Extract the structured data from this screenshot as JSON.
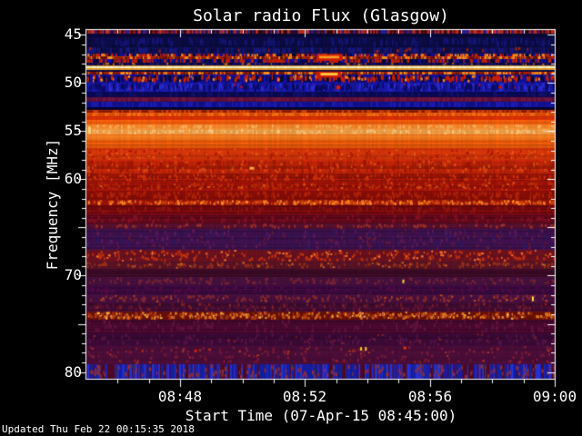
{
  "title": "Solar radio Flux (Glasgow)",
  "updated_text": "Updated Thu Feb 22 00:15:35 2018",
  "colors": {
    "background": "#000000",
    "foreground": "#ffffff"
  },
  "axes": {
    "x": {
      "label": "Start Time (07-Apr-15 08:45:00)",
      "ticks": [
        {
          "label": "08:48",
          "minutes": 3
        },
        {
          "label": "08:52",
          "minutes": 7
        },
        {
          "label": "08:56",
          "minutes": 11
        },
        {
          "label": "09:00",
          "minutes": 15
        }
      ],
      "minor_every_minutes": 1,
      "major_minutes": [
        3,
        7,
        11,
        15
      ]
    },
    "y": {
      "label": "Frequency [MHz]",
      "ticks": [
        {
          "label": "45",
          "mhz": 45
        },
        {
          "label": "50",
          "mhz": 50
        },
        {
          "label": "55",
          "mhz": 55
        },
        {
          "label": "60",
          "mhz": 60
        },
        {
          "label": "70",
          "mhz": 70
        },
        {
          "label": "80",
          "mhz": 80
        }
      ],
      "major_every_mhz": 5,
      "minor_every_mhz": 1
    }
  },
  "chart_data": {
    "type": "heatmap",
    "title": "Solar radio Flux (Glasgow)",
    "xlabel": "Start Time (07-Apr-15 08:45:00)",
    "ylabel": "Frequency [MHz]",
    "x_start_time": "08:45",
    "x_end_time": "09:00",
    "x_range_minutes": [
      0,
      15
    ],
    "y_range_mhz": [
      44.5,
      80.7
    ],
    "y_axis_inverted": true,
    "palette": "blue-red thermal (blue=low, red/orange=high, yellow/white=peak)",
    "notable_features": [
      "continuous bright yellow-white horizontal line near 48.4 MHz",
      "blue interference bands 47-52 MHz with red vertical bursts",
      "broad bright red-orange emission 53-60 MHz peaking near 55 MHz",
      "bright dashed rows near 62.4 and 74 MHz",
      "sustained burst segments 08:52:20-08:53:10 at 47.3 and 49.1 MHz",
      "blue vertical streaks along bottom edge near 80 MHz"
    ],
    "bands": [
      {
        "f0": 44.5,
        "f1": 44.85,
        "base": "#991414",
        "rj": 0.25,
        "st": [
          {
            "c": "#2222aa",
            "d": 0.45,
            "full": true
          },
          {
            "c": "#330808",
            "d": 0.3,
            "full": true
          },
          {
            "c": "#cc3322",
            "d": 0.2,
            "full": true
          }
        ]
      },
      {
        "f0": 44.85,
        "f1": 45.3,
        "base": "#0a0a3a",
        "rj": 0.15,
        "col": 0.3
      },
      {
        "f0": 45.3,
        "f1": 46.3,
        "base": "#0d0d48",
        "rj": 0.18,
        "col": 0.35,
        "st": [
          {
            "c": "#15157a",
            "d": 0.25,
            "h": 6
          }
        ]
      },
      {
        "f0": 46.3,
        "f1": 46.95,
        "base": "#111158",
        "rj": 0.18,
        "col": 0.35,
        "st": [
          {
            "c": "#1a1a80",
            "d": 0.25,
            "h": 5
          },
          {
            "c": "#aa2200",
            "d": 0.03,
            "h": 3
          }
        ]
      },
      {
        "f0": 46.95,
        "f1": 47.25,
        "base": "#1212a8",
        "col": 0.3,
        "st": [
          {
            "c": "#070733",
            "d": 0.35,
            "h": 6
          },
          {
            "c": "#cc2200",
            "d": 0.28,
            "h": 5
          },
          {
            "c": "#ff8822",
            "d": 0.15,
            "h": 3
          }
        ]
      },
      {
        "f0": 47.25,
        "f1": 47.55,
        "base": "#b32505",
        "rj": 0.25,
        "st": [
          {
            "c": "#ff9922",
            "d": 0.3,
            "h": 3
          },
          {
            "c": "#6a1202",
            "d": 0.25,
            "h": 3
          }
        ]
      },
      {
        "f0": 47.55,
        "f1": 47.85,
        "base": "#1212a8",
        "col": 0.3,
        "st": [
          {
            "c": "#070733",
            "d": 0.3,
            "h": 5
          },
          {
            "c": "#cc2200",
            "d": 0.28,
            "h": 4
          }
        ]
      },
      {
        "f0": 47.85,
        "f1": 48.18,
        "base": "#0a0a47",
        "rj": 0.15,
        "st": [
          {
            "c": "#e07818",
            "d": 0.12,
            "h": 2
          },
          {
            "c": "#131370",
            "d": 0.25,
            "h": 4
          }
        ]
      },
      {
        "f0": 48.18,
        "f1": 48.3,
        "base": "#e8a028",
        "rj": 0.15
      },
      {
        "f0": 48.3,
        "f1": 48.5,
        "base": "#ffffd8",
        "rj": 0.05
      },
      {
        "f0": 48.5,
        "f1": 48.62,
        "base": "#e8a028",
        "rj": 0.15
      },
      {
        "f0": 48.62,
        "f1": 48.85,
        "base": "#0a0a47",
        "rj": 0.15
      },
      {
        "f0": 48.85,
        "f1": 49.15,
        "base": "#b32505",
        "rj": 0.25,
        "st": [
          {
            "c": "#ff9922",
            "d": 0.35,
            "h": 3
          },
          {
            "c": "#6a1202",
            "d": 0.2,
            "h": 3
          }
        ]
      },
      {
        "f0": 49.15,
        "f1": 49.95,
        "base": "#1212a8",
        "col": 0.3,
        "st": [
          {
            "c": "#070733",
            "d": 0.3,
            "h": 6
          },
          {
            "c": "#cc2200",
            "d": 0.3,
            "h": 5
          },
          {
            "c": "#ff8822",
            "d": 0.1,
            "h": 3
          }
        ]
      },
      {
        "f0": 49.95,
        "f1": 50.9,
        "base": "#1a1ab4",
        "col": 0.4,
        "st": [
          {
            "c": "#2e2ed8",
            "d": 0.3,
            "h": 5
          },
          {
            "c": "#0b0b66",
            "d": 0.3,
            "h": 6
          },
          {
            "c": "#aa1133",
            "d": 0.015,
            "h": 3
          }
        ]
      },
      {
        "f0": 50.9,
        "f1": 51.45,
        "base": "#0a0a52",
        "rj": 0.15,
        "st": [
          {
            "c": "#12126a",
            "d": 0.2,
            "h": 5
          }
        ]
      },
      {
        "f0": 51.45,
        "f1": 51.95,
        "base": "#5c1038",
        "rj": 0.2,
        "st": [
          {
            "c": "#7a1844",
            "d": 0.3,
            "h": 4
          }
        ]
      },
      {
        "f0": 51.95,
        "f1": 52.55,
        "base": "#131398",
        "col": 0.3,
        "st": [
          {
            "c": "#1e1eb8",
            "d": 0.25,
            "h": 5
          }
        ]
      },
      {
        "f0": 52.55,
        "f1": 52.8,
        "base": "#070736",
        "rj": 0.2
      },
      {
        "f0": 52.8,
        "f1": 53.05,
        "base": "#a82408",
        "rj": 0.25,
        "st": [
          {
            "c": "#d84410",
            "d": 0.3,
            "h": 3
          }
        ]
      },
      {
        "f0": 53.05,
        "f1": 53.45,
        "base": "#e04c06",
        "rj": 0.1,
        "st": [
          {
            "c": "#ff7715",
            "d": 0.25,
            "h": 3
          }
        ]
      },
      {
        "f0": 53.45,
        "f1": 53.85,
        "base": "#d83004",
        "rj": 0.1
      },
      {
        "f0": 53.85,
        "f1": 54.35,
        "base": "#ef5c0c",
        "rj": 0.1
      },
      {
        "f0": 54.35,
        "f1": 54.75,
        "base": "#ff8c2c",
        "rj": 0.1,
        "st": [
          {
            "c": "#ffb35c",
            "d": 0.2,
            "h": 3
          }
        ]
      },
      {
        "f0": 54.75,
        "f1": 55.35,
        "base": "#ffa448",
        "rj": 0.1,
        "st": [
          {
            "c": "#ffc87c",
            "d": 0.25,
            "h": 3
          }
        ]
      },
      {
        "f0": 55.35,
        "f1": 55.95,
        "base": "#f87c1e",
        "rj": 0.1
      },
      {
        "f0": 55.95,
        "f1": 56.75,
        "base": "#ea5a0a",
        "rj": 0.12
      },
      {
        "f0": 56.75,
        "f1": 57.95,
        "base": "#d8360a",
        "rj": 0.15,
        "st": [
          {
            "c": "#f05c14",
            "d": 0.2,
            "h": 2
          },
          {
            "c": "#b81e04",
            "d": 0.2,
            "h": 3
          }
        ]
      },
      {
        "f0": 57.95,
        "f1": 59.35,
        "base": "#c62608",
        "rj": 0.18,
        "col": 0.25,
        "st": [
          {
            "c": "#e44c10",
            "d": 0.25,
            "h": 3
          },
          {
            "c": "#a51404",
            "d": 0.3,
            "h": 4
          }
        ]
      },
      {
        "f0": 59.35,
        "f1": 60.25,
        "base": "#ac1808",
        "rj": 0.2,
        "col": 0.25,
        "st": [
          {
            "c": "#d4340a",
            "d": 0.3,
            "h": 3
          }
        ]
      },
      {
        "f0": 60.25,
        "f1": 61.15,
        "base": "#9a1208",
        "rj": 0.15,
        "st": [
          {
            "c": "#c42c08",
            "d": 0.4,
            "h": 3
          },
          {
            "c": "#e86018",
            "d": 0.08,
            "h": 2
          }
        ]
      },
      {
        "f0": 61.15,
        "f1": 62.15,
        "base": "#8c0e08",
        "rj": 0.15,
        "st": [
          {
            "c": "#b42408",
            "d": 0.4,
            "h": 4
          }
        ]
      },
      {
        "f0": 62.15,
        "f1": 62.7,
        "base": "#9c1404",
        "st": [
          {
            "c": "#ff8824",
            "d": 0.45,
            "h": 3
          },
          {
            "c": "#d44210",
            "d": 0.3,
            "h": 3
          }
        ]
      },
      {
        "f0": 62.7,
        "f1": 63.6,
        "base": "#740a0e",
        "rj": 0.18,
        "st": [
          {
            "c": "#921610",
            "d": 0.25,
            "h": 4
          }
        ]
      },
      {
        "f0": 63.6,
        "f1": 64.6,
        "base": "#61091c",
        "rj": 0.18,
        "st": [
          {
            "c": "#851225",
            "d": 0.25,
            "h": 4
          }
        ]
      },
      {
        "f0": 64.6,
        "f1": 65.1,
        "base": "#551030",
        "rj": 0.2,
        "st": [
          {
            "c": "#a33028",
            "d": 0.2,
            "h": 3
          }
        ]
      },
      {
        "f0": 65.1,
        "f1": 67.3,
        "base": "#3f1250",
        "rj": 0.2,
        "st": [
          {
            "c": "#5c1c5c",
            "d": 0.28,
            "h": 4
          },
          {
            "c": "#2c1a66",
            "d": 0.1,
            "h": 5
          },
          {
            "c": "#6a1a34",
            "d": 0.12,
            "h": 3
          }
        ]
      },
      {
        "f0": 67.3,
        "f1": 68.5,
        "base": "#6e1220",
        "st": [
          {
            "c": "#c63410",
            "d": 0.42,
            "h": 3
          },
          {
            "c": "#ff7e33",
            "d": 0.12,
            "h": 2
          }
        ]
      },
      {
        "f0": 68.5,
        "f1": 69.3,
        "base": "#5a1426",
        "st": [
          {
            "c": "#9c3018",
            "d": 0.3,
            "h": 3
          },
          {
            "c": "#cc6422",
            "d": 0.07,
            "h": 2
          }
        ]
      },
      {
        "f0": 69.3,
        "f1": 70.1,
        "base": "#420c2a",
        "rj": 0.2
      },
      {
        "f0": 70.1,
        "f1": 71.0,
        "base": "#481240",
        "st": [
          {
            "c": "#7c2434",
            "d": 0.33,
            "h": 3
          }
        ]
      },
      {
        "f0": 71.0,
        "f1": 71.9,
        "base": "#3a0a3e",
        "rj": 0.2,
        "st": [
          {
            "c": "#520c46",
            "d": 0.28,
            "h": 4
          }
        ]
      },
      {
        "f0": 71.9,
        "f1": 72.8,
        "base": "#471040",
        "st": [
          {
            "c": "#8c2830",
            "d": 0.33,
            "h": 3
          },
          {
            "c": "#c44c1c",
            "d": 0.07,
            "h": 2
          }
        ]
      },
      {
        "f0": 72.8,
        "f1": 73.75,
        "base": "#400c32",
        "rj": 0.2,
        "st": [
          {
            "c": "#5e1434",
            "d": 0.28,
            "h": 4
          },
          {
            "c": "#8c2424",
            "d": 0.1,
            "h": 3
          }
        ]
      },
      {
        "f0": 73.75,
        "f1": 74.55,
        "base": "#6e1208",
        "st": [
          {
            "c": "#ea7c24",
            "d": 0.45,
            "h": 3
          },
          {
            "c": "#ffbe58",
            "d": 0.12,
            "h": 2
          },
          {
            "c": "#ac3412",
            "d": 0.3,
            "h": 3
          }
        ]
      },
      {
        "f0": 74.55,
        "f1": 76.0,
        "base": "#48092e",
        "rj": 0.2,
        "st": [
          {
            "c": "#641440",
            "d": 0.28,
            "h": 4
          }
        ]
      },
      {
        "f0": 76.0,
        "f1": 77.3,
        "base": "#3e0b38",
        "rj": 0.2,
        "st": [
          {
            "c": "#581448",
            "d": 0.28,
            "h": 4
          },
          {
            "c": "#8f2222",
            "d": 0.05,
            "h": 2
          }
        ]
      },
      {
        "f0": 77.3,
        "f1": 79.2,
        "base": "#4c0e3a",
        "st": [
          {
            "c": "#7e1c38",
            "d": 0.33,
            "h": 3
          },
          {
            "c": "#b43424",
            "d": 0.08,
            "h": 2
          }
        ]
      },
      {
        "f0": 79.2,
        "f1": 80.7,
        "base": "#500a24",
        "st": [
          {
            "c": "#2636e0",
            "d": 0.4,
            "full": true
          },
          {
            "c": "#1520a8",
            "d": 0.25,
            "full": true
          },
          {
            "c": "#8c3044",
            "d": 0.3,
            "h": 4
          }
        ]
      }
    ],
    "segments": [
      {
        "m0": 7.37,
        "m1": 8.21,
        "f0": 47.0,
        "f1": 47.7,
        "c": "#cc1c00"
      },
      {
        "m0": 7.45,
        "m1": 8.1,
        "f0": 47.18,
        "f1": 47.45,
        "c": "#ff9922"
      },
      {
        "m0": 7.37,
        "m1": 8.15,
        "f0": 48.8,
        "f1": 49.45,
        "c": "#cc1c00"
      },
      {
        "m0": 7.5,
        "m1": 8.05,
        "f0": 48.95,
        "f1": 49.22,
        "c": "#ffcc44"
      }
    ],
    "spots": [
      {
        "m": 8.07,
        "f": 50.45,
        "c": "#dd2200",
        "w": 4,
        "h": 4
      },
      {
        "m": 13.25,
        "f": 50.45,
        "c": "#cc1100",
        "w": 3,
        "h": 3
      },
      {
        "m": 5.3,
        "f": 58.85,
        "c": "#ffaa33",
        "w": 5,
        "h": 3
      },
      {
        "m": 0.1,
        "f": 54.9,
        "c": "#ffd070",
        "w": 3,
        "h": 8
      },
      {
        "m": 14.3,
        "f": 72.4,
        "c": "#ffee55",
        "w": 2,
        "h": 5
      },
      {
        "m": 10.15,
        "f": 70.6,
        "c": "#ffcc44",
        "w": 2,
        "h": 4
      },
      {
        "m": 8.8,
        "f": 77.6,
        "c": "#ffcc33",
        "w": 2,
        "h": 4
      },
      {
        "m": 8.95,
        "f": 77.6,
        "c": "#ffcc33",
        "w": 2,
        "h": 4
      },
      {
        "m": 3.5,
        "f": 77.8,
        "c": "#dd2200",
        "w": 3,
        "h": 3
      },
      {
        "m": 1.8,
        "f": 77.8,
        "c": "#cc2200",
        "w": 2,
        "h": 3
      },
      {
        "m": 10.2,
        "f": 77.5,
        "c": "#ee3311",
        "w": 3,
        "h": 3
      }
    ]
  }
}
